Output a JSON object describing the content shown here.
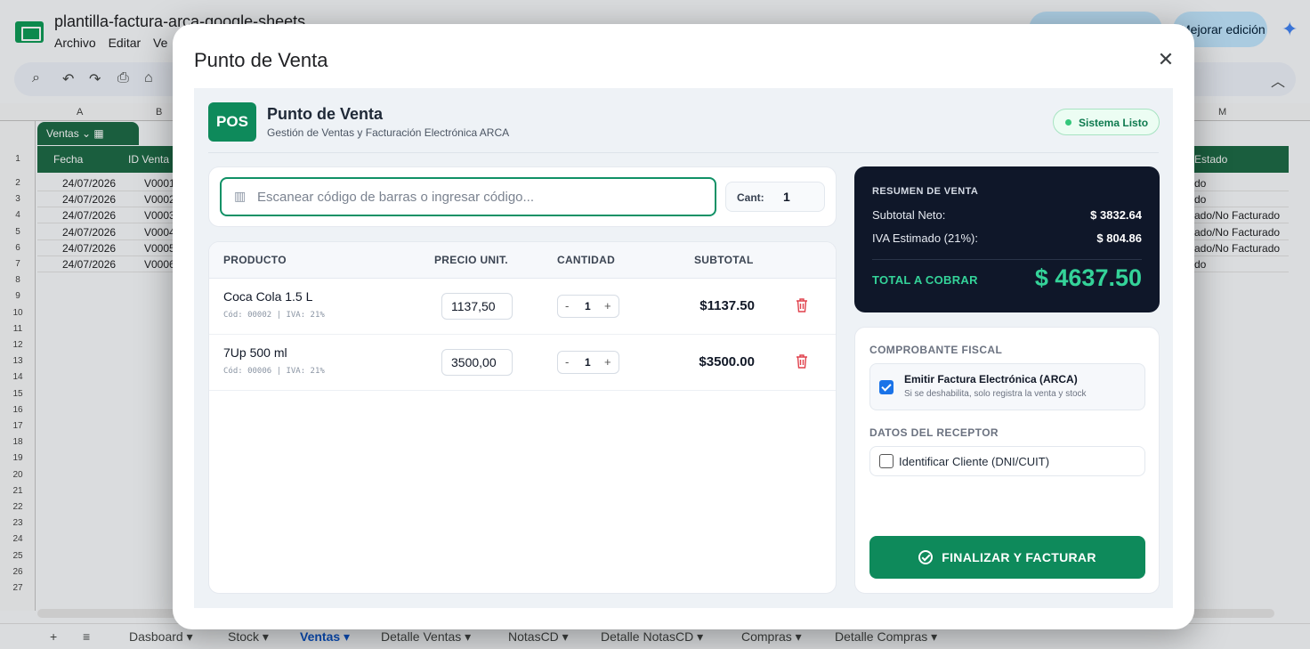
{
  "spreadsheet": {
    "title": "plantilla-factura-arca-google-sheets",
    "menu": [
      "Archivo",
      "Editar",
      "Ve"
    ],
    "improve_label": "Mejorar edición",
    "table_name": "Ventas",
    "columns_visible": [
      "A",
      "B",
      "M"
    ],
    "header_cells": {
      "fecha": "Fecha",
      "id_venta": "ID Venta",
      "estado": "Estado"
    },
    "rows": [
      {
        "fecha": "24/07/2026",
        "id": "V0001",
        "estado": "do"
      },
      {
        "fecha": "24/07/2026",
        "id": "V0002",
        "estado": "do"
      },
      {
        "fecha": "24/07/2026",
        "id": "V0003",
        "estado": "ado/No Facturado"
      },
      {
        "fecha": "24/07/2026",
        "id": "V0004",
        "estado": "ado/No Facturado"
      },
      {
        "fecha": "24/07/2026",
        "id": "V0005",
        "estado": "ado/No Facturado"
      },
      {
        "fecha": "24/07/2026",
        "id": "V0006",
        "estado": "do"
      }
    ],
    "row_numbers": [
      "1",
      "2",
      "3",
      "4",
      "5",
      "6",
      "7",
      "8",
      "9",
      "10",
      "11",
      "12",
      "13",
      "14",
      "15",
      "16",
      "17",
      "18",
      "19",
      "20",
      "21",
      "22",
      "23",
      "24",
      "25",
      "26",
      "27"
    ],
    "sheet_tabs": [
      "Dasboard",
      "Stock",
      "Ventas",
      "Detalle Ventas",
      "NotasCD",
      "Detalle NotasCD",
      "Compras",
      "Detalle Compras"
    ],
    "active_tab": "Ventas"
  },
  "modal": {
    "title": "Punto de Venta",
    "close_icon": "close-icon"
  },
  "pos": {
    "logo": "POS",
    "name": "Punto de Venta",
    "subtitle": "Gestión de Ventas y Facturación Electrónica ARCA",
    "status": "Sistema Listo",
    "scan_placeholder": "Escanear código de barras o ingresar código...",
    "scan_value": "",
    "qty_label": "Cant:",
    "qty_value": "1",
    "table_headers": {
      "producto": "PRODUCTO",
      "precio": "PRECIO UNIT.",
      "cantidad": "CANTIDAD",
      "subtotal": "SUBTOTAL"
    },
    "items": [
      {
        "name": "Coca Cola 1.5 L",
        "meta": "Cód: 00002 | IVA: 21%",
        "price": "1137,50",
        "qty": "1",
        "minus": "-",
        "plus": "+",
        "subtotal": "$1137.50"
      },
      {
        "name": "7Up 500 ml",
        "meta": "Cód: 00006 | IVA: 21%",
        "price": "3500,00",
        "qty": "1",
        "minus": "-",
        "plus": "+",
        "subtotal": "$3500.00"
      }
    ]
  },
  "summary": {
    "title": "RESUMEN DE VENTA",
    "subtotal_label": "Subtotal Neto:",
    "subtotal_value": "$ 3832.64",
    "iva_label": "IVA Estimado (21%):",
    "iva_value": "$ 804.86",
    "total_label": "TOTAL A COBRAR",
    "total_value": "$ 4637.50"
  },
  "fiscal": {
    "section_title": "COMPROBANTE FISCAL",
    "invoice_label": "Emitir Factura Electrónica (ARCA)",
    "invoice_hint": "Si se deshabilita, solo registra la venta y stock",
    "invoice_checked": true,
    "receptor_title": "DATOS DEL RECEPTOR",
    "client_label": "Identificar Cliente (DNI/CUIT)",
    "client_checked": false,
    "finalize_label": "FINALIZAR Y FACTURAR"
  },
  "colors": {
    "brand_green": "#0e8a5b",
    "summary_bg": "#0f1729",
    "total_green": "#34d399",
    "sheet_header_green": "#1e6b47"
  }
}
